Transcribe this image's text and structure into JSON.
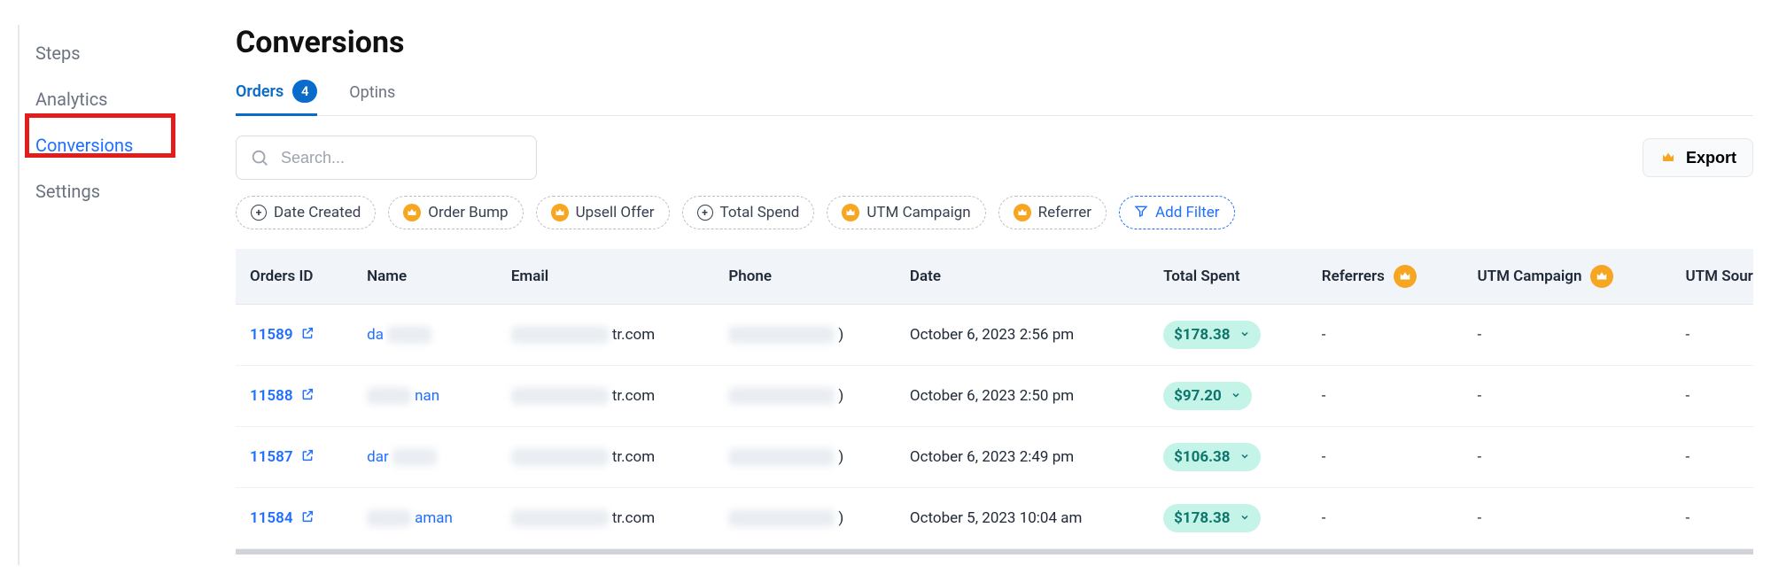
{
  "sidebar": {
    "items": [
      {
        "label": "Steps",
        "active": false
      },
      {
        "label": "Analytics",
        "active": false
      },
      {
        "label": "Conversions",
        "active": true
      },
      {
        "label": "Settings",
        "active": false
      }
    ]
  },
  "header": {
    "title": "Conversions"
  },
  "tabs": {
    "orders": {
      "label": "Orders",
      "count": "4"
    },
    "optins": {
      "label": "Optins"
    }
  },
  "toolbar": {
    "search_placeholder": "Search...",
    "export_label": "Export",
    "icons": {
      "crown": "crown-icon"
    }
  },
  "filters": [
    {
      "label": "Date Created",
      "icon": "plus"
    },
    {
      "label": "Order Bump",
      "icon": "crown"
    },
    {
      "label": "Upsell Offer",
      "icon": "crown"
    },
    {
      "label": "Total Spend",
      "icon": "plus"
    },
    {
      "label": "UTM Campaign",
      "icon": "crown"
    },
    {
      "label": "Referrer",
      "icon": "crown"
    },
    {
      "label": "Add Filter",
      "icon": "filter",
      "add": true
    }
  ],
  "table": {
    "columns": [
      "Orders ID",
      "Name",
      "Email",
      "Phone",
      "Date",
      "Total Spent",
      "Referrers",
      "UTM Campaign",
      "UTM Source"
    ],
    "premium_columns": [
      "Referrers",
      "UTM Campaign"
    ],
    "rows": [
      {
        "id": "11589",
        "name_prefix": "da",
        "email_suffix": "tr.com",
        "phone_suffix": ")",
        "date": "October 6, 2023 2:56 pm",
        "spent": "$178.38",
        "ref": "-",
        "utm_c": "-",
        "utm_s": "-"
      },
      {
        "id": "11588",
        "name_prefix": "",
        "name_suffix": "nan",
        "email_suffix": "tr.com",
        "phone_suffix": ")",
        "date": "October 6, 2023 2:50 pm",
        "spent": "$97.20",
        "ref": "-",
        "utm_c": "-",
        "utm_s": "-"
      },
      {
        "id": "11587",
        "name_prefix": "dar",
        "email_suffix": "tr.com",
        "phone_suffix": ")",
        "date": "October 6, 2023 2:49 pm",
        "spent": "$106.38",
        "ref": "-",
        "utm_c": "-",
        "utm_s": "-"
      },
      {
        "id": "11584",
        "name_prefix": "",
        "name_suffix": "aman",
        "email_suffix": "tr.com",
        "phone_suffix": ")",
        "date": "October 5, 2023 10:04 am",
        "spent": "$178.38",
        "ref": "-",
        "utm_c": "-",
        "utm_s": "-"
      }
    ]
  }
}
